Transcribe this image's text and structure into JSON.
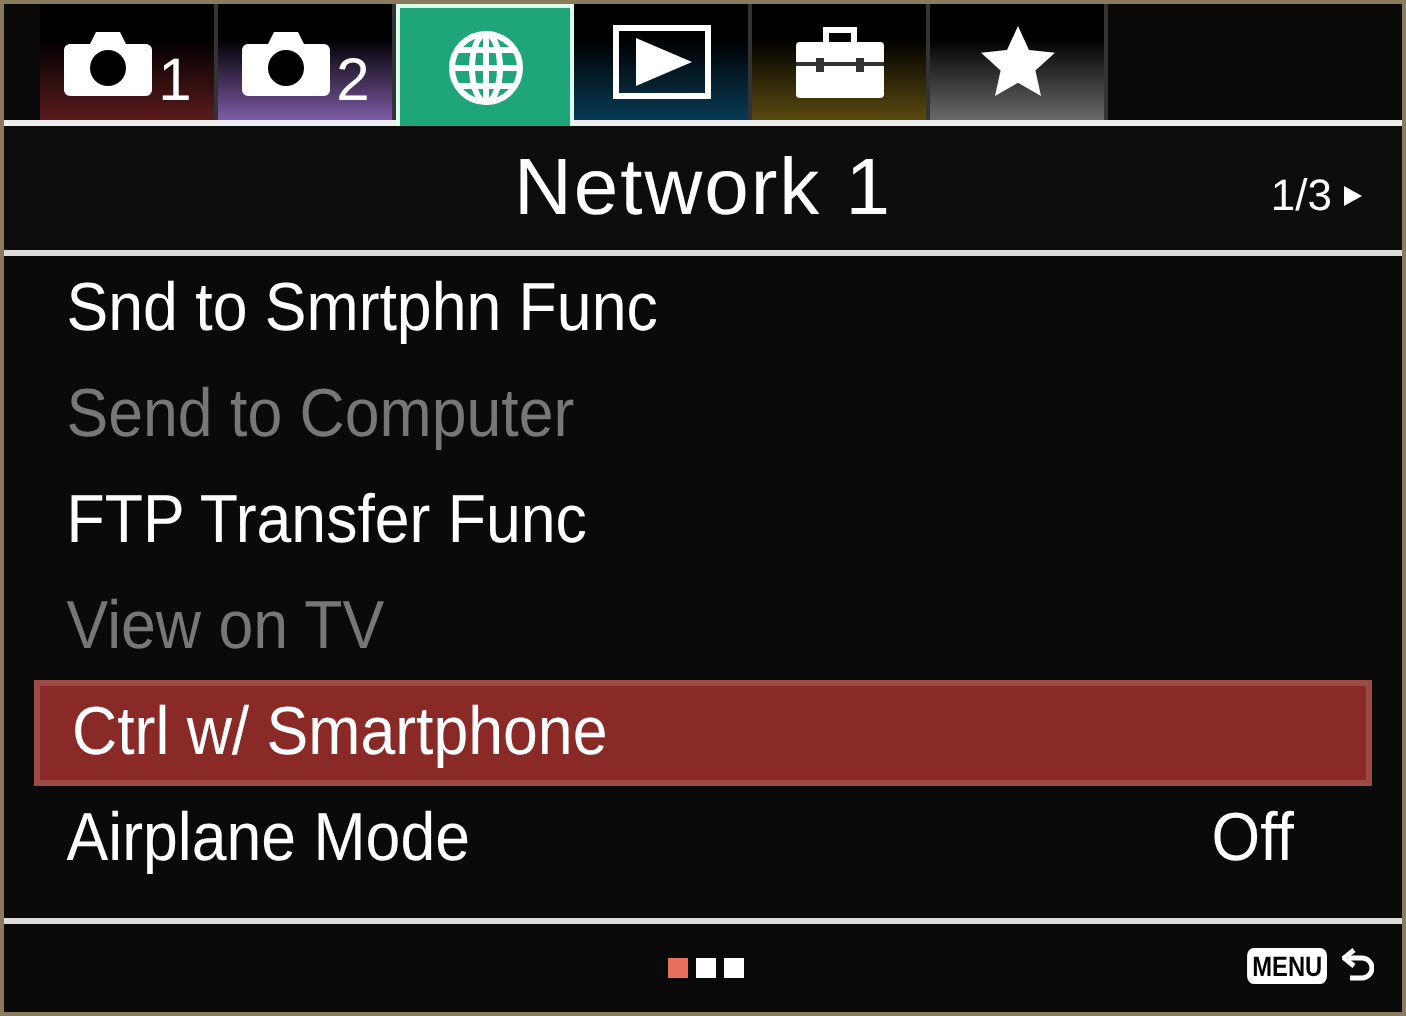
{
  "tabs": [
    {
      "kind": "camera",
      "number": "1",
      "color": "#5a1a1c",
      "selected": false
    },
    {
      "kind": "camera",
      "number": "2",
      "color": "#7e5aa6",
      "selected": false
    },
    {
      "kind": "network",
      "color": "#1fa57a",
      "selected": true
    },
    {
      "kind": "playback",
      "color": "#0a3a55",
      "selected": false
    },
    {
      "kind": "setup",
      "color": "#5a4a10",
      "selected": false
    },
    {
      "kind": "custom",
      "color": "#6a6a6a",
      "selected": false
    }
  ],
  "header": {
    "title": "Network 1",
    "page": "1/3"
  },
  "items": [
    {
      "label": "Snd to Smrtphn Func",
      "disabled": false,
      "selected": false
    },
    {
      "label": "Send to Computer",
      "disabled": true,
      "selected": false
    },
    {
      "label": "FTP Transfer Func",
      "disabled": false,
      "selected": false
    },
    {
      "label": "View on TV",
      "disabled": true,
      "selected": false
    },
    {
      "label": "Ctrl w/ Smartphone",
      "disabled": false,
      "selected": true
    },
    {
      "label": "Airplane Mode",
      "value": "Off",
      "disabled": false,
      "selected": false
    }
  ],
  "footer": {
    "pages": [
      {
        "selected": true
      },
      {
        "selected": false
      },
      {
        "selected": false
      }
    ],
    "menu_key": "MENU"
  }
}
